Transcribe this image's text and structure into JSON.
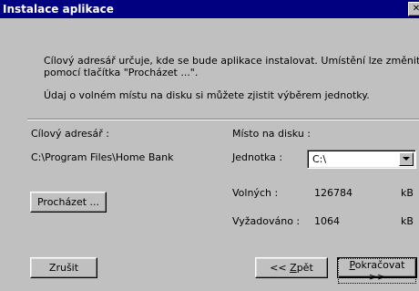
{
  "window": {
    "title": "Instalace aplikace",
    "close_icon": "close-icon"
  },
  "intro": {
    "line1": "Cílový adresář určuje, kde se bude aplikace instalovat. Umístění lze změnit",
    "line2": "pomocí tlačítka \"Procházet ...\".",
    "line3": "Údaj o volném místu na disku si můžete zjistit výběrem jednotky."
  },
  "target": {
    "label": "Cílový adresář :",
    "path": "C:\\Program Files\\Home Bank",
    "browse_button": "Procházet ..."
  },
  "disk": {
    "label": "Místo na disku :",
    "drive_label": "Jednotka :",
    "drive_value": "C:\\",
    "free_label": "Volných :",
    "free_value": "126784",
    "free_unit": "kB",
    "required_label": "Vyžadováno :",
    "required_value": "1064",
    "required_unit": "kB"
  },
  "buttons": {
    "cancel": "Zrušit",
    "back_prefix": "<< ",
    "back_mnemonic": "Z",
    "back_rest": "pět",
    "next_mnemonic": "P",
    "next_rest": "okračovat >>"
  }
}
